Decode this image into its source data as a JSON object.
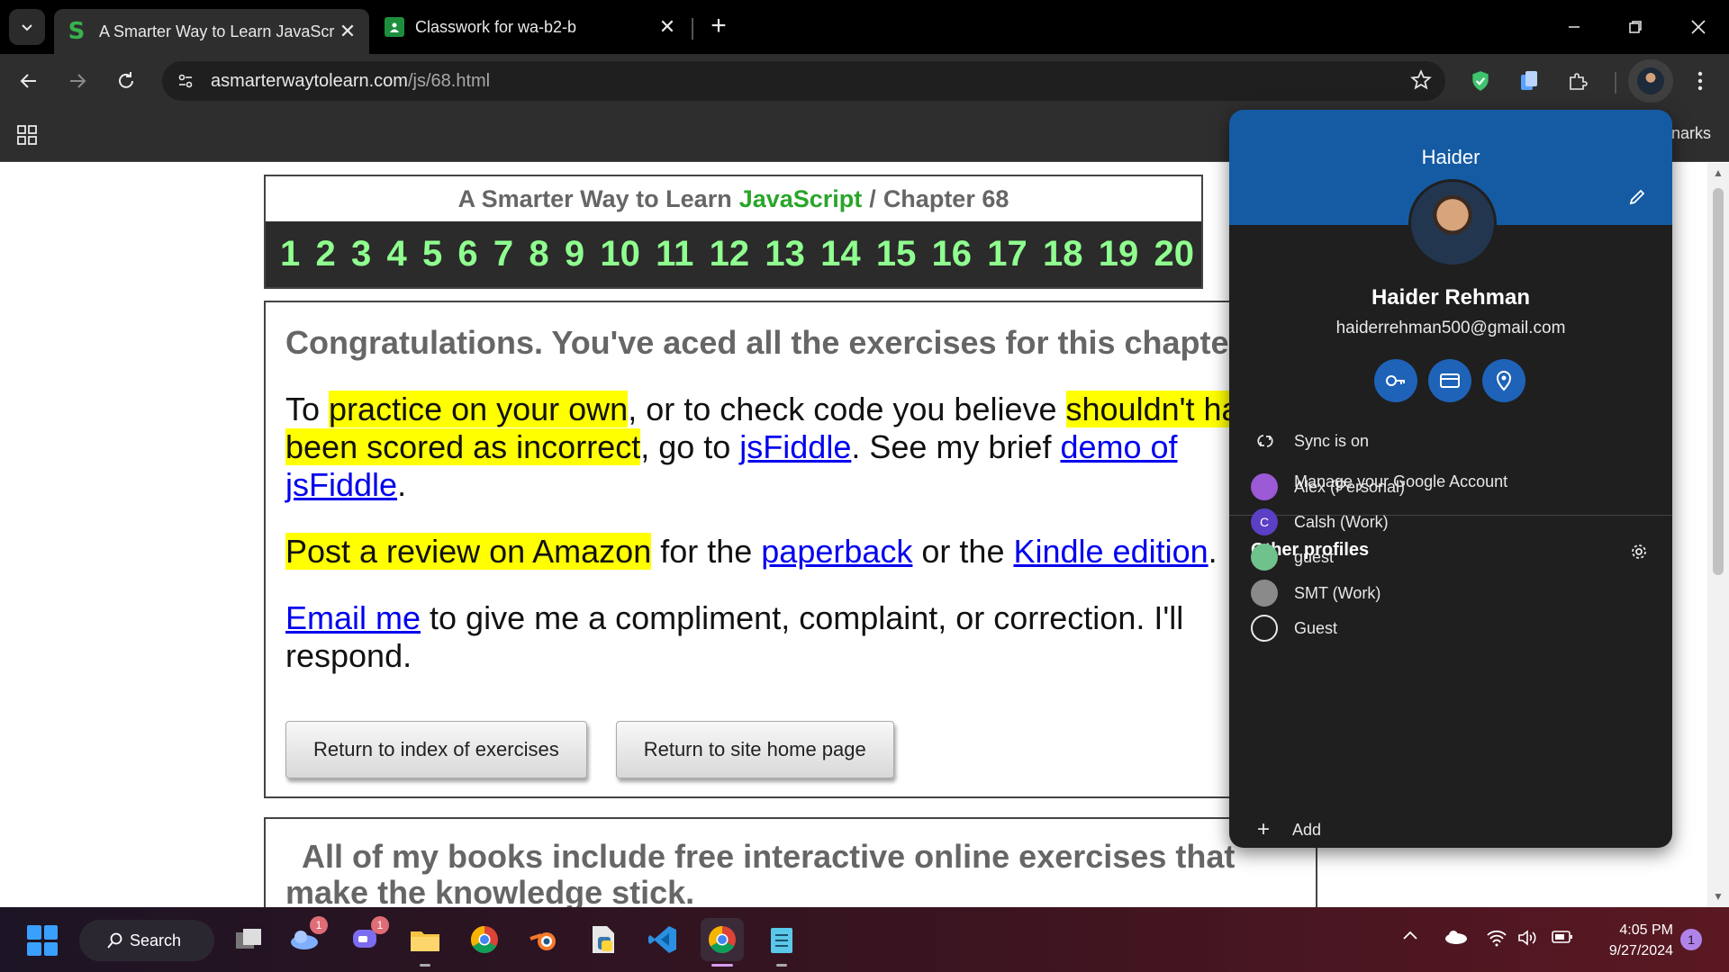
{
  "tabs": [
    {
      "title": "A Smarter Way to Learn JavaScr",
      "active": true
    },
    {
      "title": "Classwork for wa-b2-b",
      "active": false
    }
  ],
  "omnibox": {
    "domain": "asmarterwaytolearn.com",
    "path": "/js/68.html"
  },
  "bookmarks": {
    "trailing_text": "narks"
  },
  "page": {
    "header": {
      "brand": "A Smarter Way to Learn",
      "js": "JavaScript",
      "separator": "/",
      "chapter": "Chapter 68"
    },
    "chapters": [
      "1",
      "2",
      "3",
      "4",
      "5",
      "6",
      "7",
      "8",
      "9",
      "10",
      "11",
      "12",
      "13",
      "14",
      "15",
      "16",
      "17",
      "18",
      "19",
      "20"
    ],
    "congrats": "Congratulations. You've aced all the exercises for this chapter.",
    "p1": {
      "t1": "To ",
      "h1": "practice on your own",
      "t2": ", or to check code you believe ",
      "h2": "shouldn't have been scored as incorrect",
      "t3": ", go to ",
      "l1": "jsFiddle",
      "t4": ". See my brief ",
      "l2": "demo of jsFiddle",
      "t5": "."
    },
    "p2": {
      "h1": "Post a review on Amazon",
      "t1": " for the ",
      "l1": "paperback",
      "t2": " or the ",
      "l2": "Kindle edition",
      "t3": "."
    },
    "p3": {
      "l1": "Email me",
      "t1": " to give me a compliment, complaint, or correction. I'll respond."
    },
    "buttons": {
      "index": "Return to index of exercises",
      "home": "Return to site home page"
    },
    "books": "All of my books include free interactive online exercises that make the knowledge stick."
  },
  "profile_popup": {
    "banner_name": "Haider",
    "full_name": "Haider Rehman",
    "email": "haiderrehman500@gmail.com",
    "sync": "Sync is on",
    "manage": "Manage your Google Account",
    "other_profiles_title": "Other profiles",
    "profiles": [
      {
        "name": "Alex (Personal)",
        "color": "#9b59d6",
        "initial": ""
      },
      {
        "name": "Calsh (Work)",
        "color": "#5b3fc4",
        "initial": "C"
      },
      {
        "name": "guest",
        "color": "#6fc28b",
        "initial": ""
      },
      {
        "name": "SMT (Work)",
        "color": "#8a8a8a",
        "initial": ""
      },
      {
        "name": "Guest",
        "color": "transparent",
        "initial": ""
      }
    ],
    "add": "Add"
  },
  "taskbar": {
    "search": "Search",
    "badges": {
      "weather": "1",
      "teams": "1"
    },
    "time": "4:05 PM",
    "date": "9/27/2024",
    "notifications": "1"
  },
  "colors": {
    "accent_banner": "#155ba3",
    "highlight": "#ffff00",
    "chapter_green": "#8fff8f"
  }
}
